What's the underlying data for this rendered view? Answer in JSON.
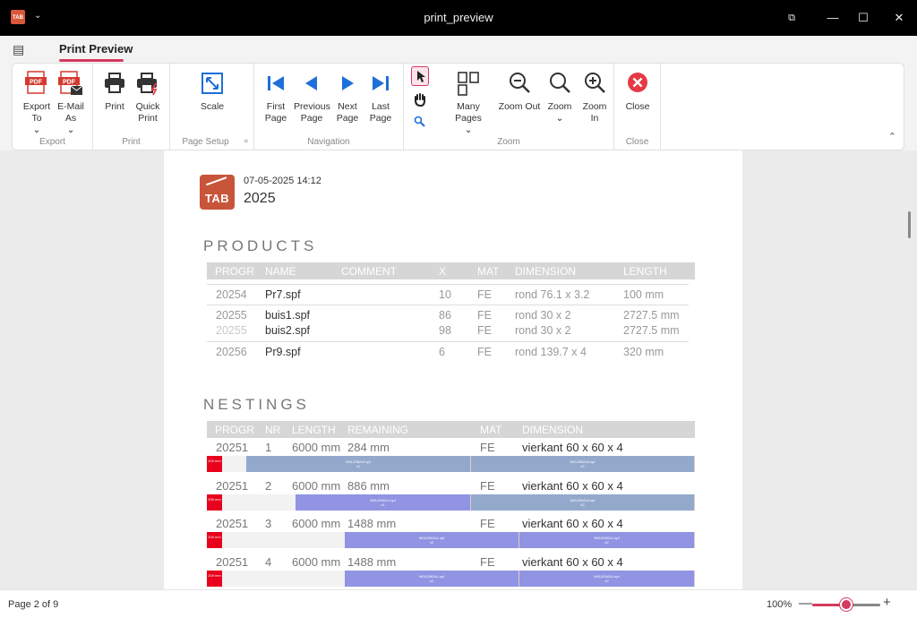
{
  "window": {
    "title": "print_preview",
    "app_icon_text": "TAB",
    "qat_symbol": "⌄",
    "controls": {
      "restore_other": "⧉",
      "minimize": "—",
      "maximize": "☐",
      "close": "✕"
    }
  },
  "ribbon": {
    "menu_icon": "▤",
    "active_tab": "Print Preview",
    "collapse_symbol": "⌃",
    "groups": {
      "export": {
        "label": "Export",
        "export_to": "Export To",
        "email_as": "E-Mail As",
        "chevron": "⌄"
      },
      "print": {
        "label": "Print",
        "print": "Print",
        "quick_print": "Quick Print"
      },
      "page_setup": {
        "label": "Page Setup",
        "scale": "Scale",
        "launcher": "⌗"
      },
      "navigation": {
        "label": "Navigation",
        "first": "First Page",
        "previous": "Previous Page",
        "next": "Next Page",
        "last": "Last Page"
      },
      "zoom": {
        "label": "Zoom",
        "many_pages": "Many Pages",
        "zoom_out": "Zoom Out",
        "zoom": "Zoom",
        "zoom_in": "Zoom In"
      },
      "close": {
        "label": "Close",
        "close": "Close"
      }
    }
  },
  "report": {
    "logo_text": "TAB",
    "date": "07-05-2025 14:12",
    "year": "2025",
    "products": {
      "title": "PRODUCTS",
      "headers": [
        "PROGR",
        "NAME",
        "COMMENT",
        "X",
        "MAT",
        "DIMENSION",
        "LENGTH"
      ],
      "rows": [
        {
          "progr": "20254",
          "name": "Pr7.spf",
          "x": "10",
          "mat": "FE",
          "dimension": "rond 76.1 x 3.2",
          "length": "100 mm"
        },
        {
          "progr": "20255",
          "name": "buis1.spf",
          "x": "86",
          "mat": "FE",
          "dimension": "rond 30 x 2",
          "length": "2727.5 mm"
        },
        {
          "progr": "20255",
          "name": "buis2.spf",
          "x": "98",
          "mat": "FE",
          "dimension": "rond 30 x 2",
          "length": "2727.5 mm"
        },
        {
          "progr": "20256",
          "name": "Pr9.spf",
          "x": "6",
          "mat": "FE",
          "dimension": "rond 139.7 x 4",
          "length": "320 mm"
        }
      ]
    },
    "nestings": {
      "title": "NESTINGS",
      "headers": [
        "PROGR",
        "NR",
        "LENGTH",
        "REMAINING",
        "MAT",
        "DIMENSION"
      ],
      "rows": [
        {
          "progr": "20251",
          "nr": "1",
          "length": "6000 mm",
          "remaining": "284 mm",
          "mat": "FE",
          "dimension": "vierkant 60 x 60 x 4",
          "tag": "200 mm",
          "segments": [
            {
              "label": "W0L2062x2.spf",
              "qty": "x1"
            },
            {
              "label": "W0L2062x2.spf",
              "qty": "x2"
            }
          ]
        },
        {
          "progr": "20251",
          "nr": "2",
          "length": "6000 mm",
          "remaining": "886 mm",
          "mat": "FE",
          "dimension": "vierkant 60 x 60 x 4",
          "tag": "200 mm",
          "segments": [
            {
              "label": "W0U2062x1.spf",
              "qty": "x1"
            },
            {
              "label": "W0L2062x2.spf",
              "qty": "x2"
            }
          ]
        },
        {
          "progr": "20251",
          "nr": "3",
          "length": "6000 mm",
          "remaining": "1488 mm",
          "mat": "FE",
          "dimension": "vierkant 60 x 60 x 4",
          "tag": "200 mm",
          "segments": [
            {
              "label": "W0U2062x1.spf",
              "qty": "x2"
            },
            {
              "label": "W0U2062x1.spf",
              "qty": "x2"
            }
          ]
        },
        {
          "progr": "20251",
          "nr": "4",
          "length": "6000 mm",
          "remaining": "1488 mm",
          "mat": "FE",
          "dimension": "vierkant 60 x 60 x 4",
          "tag": "200 mm",
          "segments": [
            {
              "label": "W0U2062x1.spf",
              "qty": "x2"
            },
            {
              "label": "W0U2062x1.spf",
              "qty": "x2"
            }
          ]
        }
      ]
    }
  },
  "status": {
    "page": "Page 2 of 9",
    "zoom": "100%",
    "zoom_minus": "—",
    "zoom_plus": "+",
    "zoom_slider_fraction": 0.5
  },
  "colors": {
    "accent": "#d33a5e",
    "nav_blue": "#1e6fd9",
    "close_red": "#e63946",
    "logo": "#c8553a"
  }
}
